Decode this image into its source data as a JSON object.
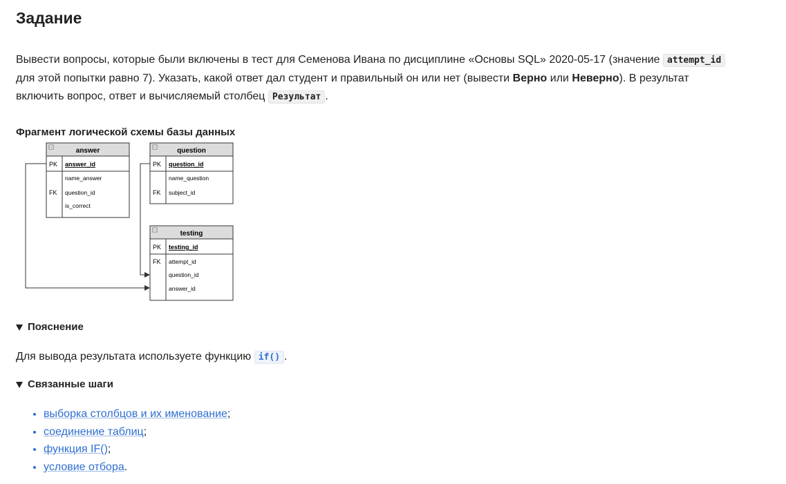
{
  "page": {
    "title": "Задание"
  },
  "task": {
    "part1": "Вывести вопросы, которые были включены в тест для Семенова Ивана по дисциплине «Основы SQL» 2020-05-17  (значение ",
    "code1": "attempt_id",
    "part2": " для этой попытки равно 7). Указать, какой ответ дал студент и правильный он или нет (вывести ",
    "bold1": "Верно",
    "part3": " или ",
    "bold2": "Неверно",
    "part4": "). В результат включить вопрос, ответ и вычисляемый столбец ",
    "code2": "Результат",
    "part5": "."
  },
  "schema": {
    "title": "Фрагмент логической схемы базы данных",
    "tables": {
      "answer": {
        "name": "answer",
        "pk_label": "PK",
        "fk_label": "FK",
        "pk": "answer_id",
        "fields": [
          "name_answer",
          "question_id",
          "is_correct"
        ]
      },
      "question": {
        "name": "question",
        "pk_label": "PK",
        "fk_label": "FK",
        "pk": "question_id",
        "fields": [
          "name_question",
          "subject_id"
        ]
      },
      "testing": {
        "name": "testing",
        "pk_label": "PK",
        "fk_label": "FK",
        "pk": "testing_id",
        "fields": [
          "attempt_id",
          "question_id",
          "answer_id"
        ]
      }
    }
  },
  "explanation": {
    "summary": "Пояснение",
    "text": "Для вывода результата используете функцию ",
    "code": "if()",
    "end": "."
  },
  "related": {
    "summary": "Связанные шаги",
    "items": [
      {
        "link": "выборка столбцов и их именование",
        "end": ";"
      },
      {
        "link": "соединение таблиц",
        "end": ";"
      },
      {
        "link": "функция IF()",
        "end": ";"
      },
      {
        "link": "условие отбора",
        "end": "."
      }
    ]
  },
  "colors": {
    "link": "#2f6fcf",
    "table_header": "#dcdcdc",
    "table_border": "#333333"
  },
  "icons": {
    "collapse": "minus-box-icon",
    "disclosure": "triangle-down-icon"
  }
}
